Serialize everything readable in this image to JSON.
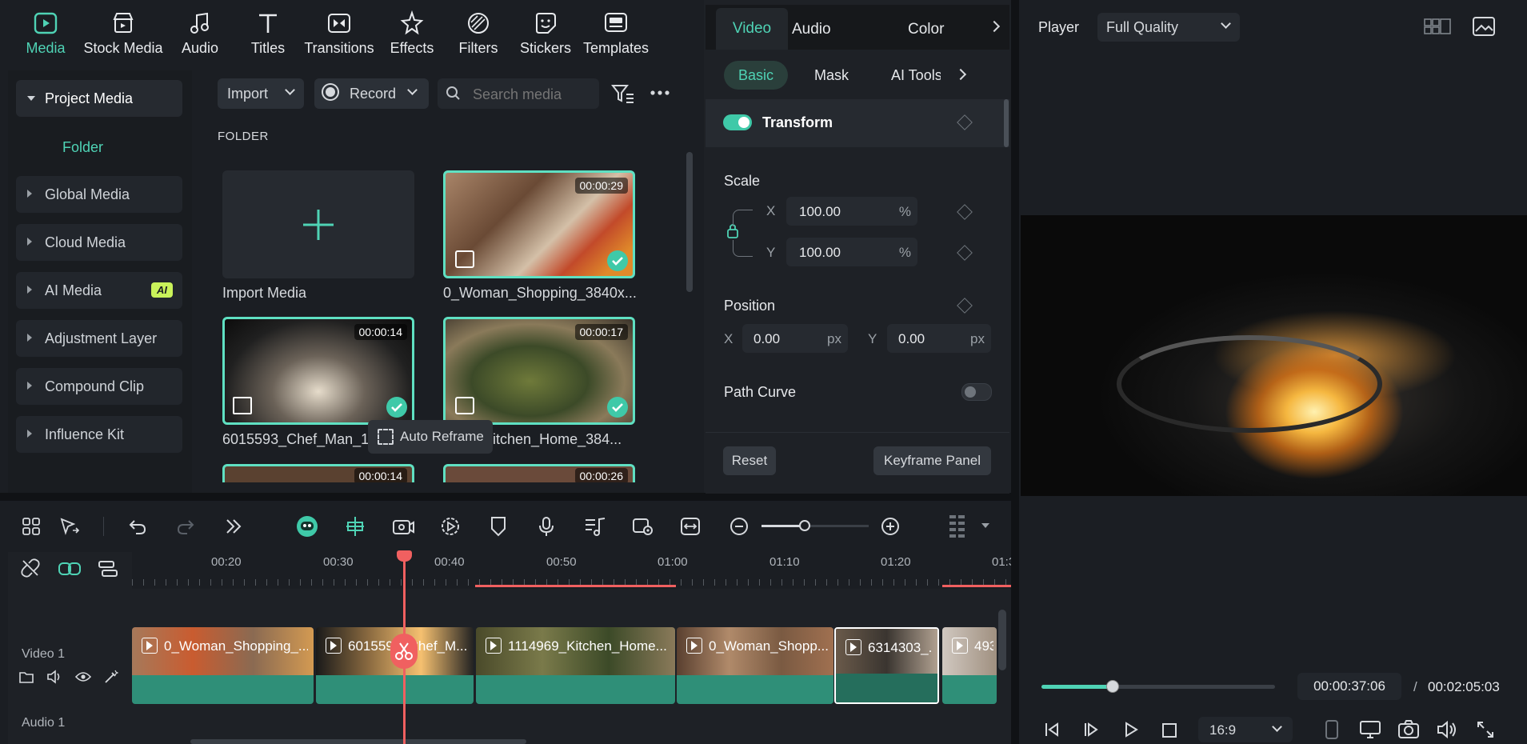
{
  "top_tabs": [
    {
      "label": "Media",
      "icon": "media-icon",
      "active": true
    },
    {
      "label": "Stock Media",
      "icon": "stock-media-icon"
    },
    {
      "label": "Audio",
      "icon": "audio-note-icon"
    },
    {
      "label": "Titles",
      "icon": "titles-icon"
    },
    {
      "label": "Transitions",
      "icon": "transitions-icon"
    },
    {
      "label": "Effects",
      "icon": "effects-icon"
    },
    {
      "label": "Filters",
      "icon": "filters-icon"
    },
    {
      "label": "Stickers",
      "icon": "stickers-icon"
    },
    {
      "label": "Templates",
      "icon": "templates-icon"
    }
  ],
  "sidebar": {
    "items": [
      {
        "label": "Project Media",
        "expanded": true
      },
      {
        "label": "Folder"
      },
      {
        "label": "Global Media"
      },
      {
        "label": "Cloud Media"
      },
      {
        "label": "AI Media",
        "badge": "AI"
      },
      {
        "label": "Adjustment Layer"
      },
      {
        "label": "Compound Clip"
      },
      {
        "label": "Influence Kit"
      }
    ]
  },
  "media_toolbar": {
    "import": "Import",
    "record": "Record",
    "search_placeholder": "Search media"
  },
  "folder_label": "FOLDER",
  "media": {
    "import_label": "Import Media",
    "items": [
      {
        "name": "0_Woman_Shopping_3840x...",
        "duration": "00:00:29"
      },
      {
        "name": "6015593_Chef_Man_19",
        "duration": "00:00:14"
      },
      {
        "name": "9_Kitchen_Home_384...",
        "duration": "00:00:17"
      },
      {
        "duration": "00:00:14"
      },
      {
        "duration": "00:00:26"
      }
    ],
    "tooltip": "Auto Reframe"
  },
  "props": {
    "tabs": [
      "Video",
      "Audio",
      "Color"
    ],
    "subtabs": [
      "Basic",
      "Mask",
      "AI Tools"
    ],
    "transform": "Transform",
    "scale": "Scale",
    "scale_x": "100.00",
    "scale_y": "100.00",
    "pct": "%",
    "position": "Position",
    "pos_x": "0.00",
    "pos_y": "0.00",
    "px": "px",
    "x": "X",
    "y": "Y",
    "path_curve": "Path Curve",
    "reset": "Reset",
    "keyframe": "Keyframe Panel"
  },
  "player": {
    "label": "Player",
    "quality": "Full Quality",
    "current_time": "00:00:37:06",
    "separator": "/",
    "total_time": "00:02:05:03",
    "aspect": "16:9",
    "progress": 0.3
  },
  "timeline": {
    "ruler": [
      "00:20",
      "00:30",
      "00:40",
      "00:50",
      "01:00",
      "01:10",
      "01:20",
      "01:3"
    ],
    "tracks": {
      "video": "Video 1",
      "audio": "Audio 1"
    },
    "clips": [
      "0_Woman_Shopping_...",
      "6015593_Chef_M...",
      "1114969_Kitchen_Home...",
      "0_Woman_Shopp...",
      "6314303_...",
      "493"
    ]
  },
  "colors": {
    "accent": "#4fd3b5",
    "playhead": "#f06060",
    "clip": "#2f8f78"
  }
}
